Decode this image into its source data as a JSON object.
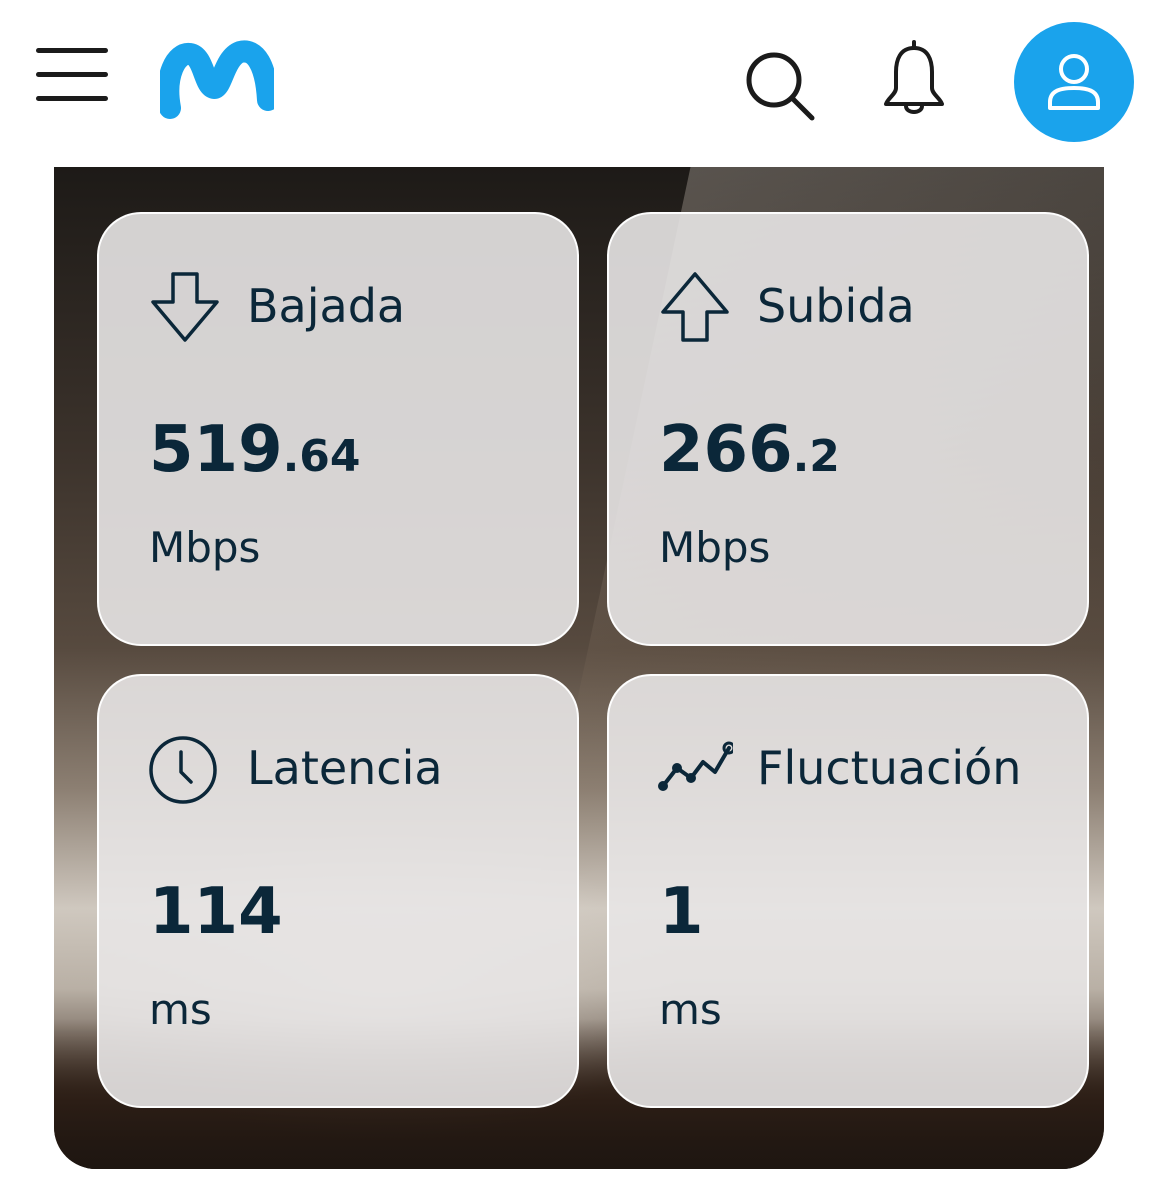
{
  "header": {
    "menu_icon": "hamburger-menu-icon",
    "logo": "movistar-logo",
    "search_icon": "search-icon",
    "notifications_icon": "bell-icon",
    "profile_icon": "user-icon"
  },
  "colors": {
    "brand_blue": "#1aa3ec",
    "text_dark": "#0b2739"
  },
  "results": {
    "download": {
      "label": "Bajada",
      "value_int": "519",
      "value_dec": ".64",
      "unit": "Mbps",
      "icon": "download-arrow-icon"
    },
    "upload": {
      "label": "Subida",
      "value_int": "266",
      "value_dec": ".2",
      "unit": "Mbps",
      "icon": "upload-arrow-icon"
    },
    "latency": {
      "label": "Latencia",
      "value_int": "114",
      "value_dec": "",
      "unit": "ms",
      "icon": "clock-icon"
    },
    "jitter": {
      "label": "Fluctuación",
      "value_int": "1",
      "value_dec": "",
      "unit": "ms",
      "icon": "line-chart-icon"
    }
  }
}
